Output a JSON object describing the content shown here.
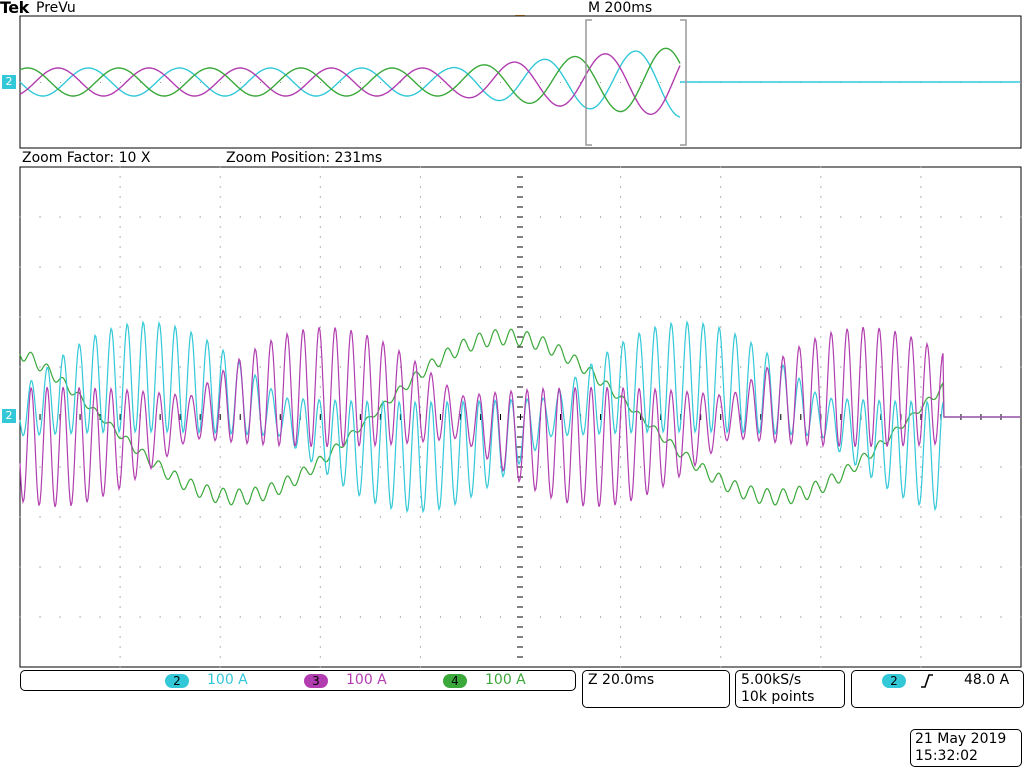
{
  "header": {
    "brand": "Tek",
    "mode": "PreVu",
    "timebase": "M 200ms"
  },
  "zoom": {
    "factor": "Zoom Factor: 10 X",
    "position": "Zoom Position: 231ms"
  },
  "channels": [
    {
      "num": "2",
      "scale": "100 A",
      "color": "#33c8d8"
    },
    {
      "num": "3",
      "scale": "100 A",
      "color": "#b23db0"
    },
    {
      "num": "4",
      "scale": "100 A",
      "color": "#3aa83a"
    }
  ],
  "zoom_timebase": "Z 20.0ms",
  "sample": {
    "rate": "5.00kS/s",
    "points": "10k points"
  },
  "trigger": {
    "channel": "2",
    "slope_icon": "rising-edge-icon",
    "level": "48.0 A"
  },
  "datetime": {
    "date": "21 May 2019",
    "time": "15:32:02"
  },
  "ground_marker": "2",
  "colors": {
    "ch2": "#33c8d8",
    "ch3": "#b23db0",
    "ch4": "#3aa83a",
    "ch2_dark": "#1f7a80",
    "bg": "#ffffff",
    "grid": "#000000"
  }
}
